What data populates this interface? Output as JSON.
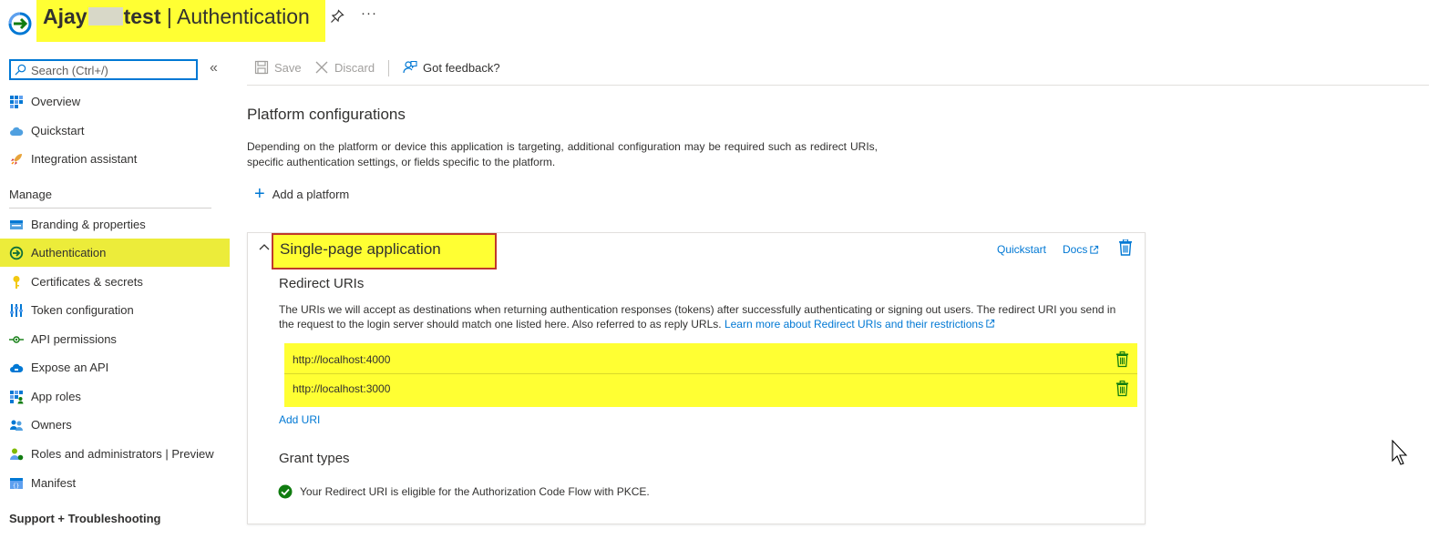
{
  "header": {
    "app_name_start": "Ajay",
    "app_name_end": "test",
    "separator": " | ",
    "page": "Authentication",
    "more": "···"
  },
  "sidebar": {
    "search_placeholder": "Search (Ctrl+/)",
    "collapse": "«",
    "items": [
      {
        "label": "Overview",
        "icon": "grid-icon"
      },
      {
        "label": "Quickstart",
        "icon": "cloud-icon"
      },
      {
        "label": "Integration assistant",
        "icon": "rocket-icon"
      }
    ],
    "manage_label": "Manage",
    "manage_items": [
      {
        "label": "Branding & properties",
        "icon": "branding-icon"
      },
      {
        "label": "Authentication",
        "icon": "authentication-icon",
        "active": true
      },
      {
        "label": "Certificates & secrets",
        "icon": "key-icon"
      },
      {
        "label": "Token configuration",
        "icon": "token-icon"
      },
      {
        "label": "API permissions",
        "icon": "api-permissions-icon"
      },
      {
        "label": "Expose an API",
        "icon": "cloud-api-icon"
      },
      {
        "label": "App roles",
        "icon": "app-roles-icon"
      },
      {
        "label": "Owners",
        "icon": "owners-icon"
      },
      {
        "label": "Roles and administrators | Preview",
        "icon": "roles-icon"
      },
      {
        "label": "Manifest",
        "icon": "manifest-icon"
      }
    ],
    "support_label": "Support + Troubleshooting"
  },
  "toolbar": {
    "save": "Save",
    "discard": "Discard",
    "feedback": "Got feedback?"
  },
  "main": {
    "title": "Platform configurations",
    "description": "Depending on the platform or device this application is targeting, additional configuration may be required such as redirect URIs, specific authentication settings, or fields specific to the platform.",
    "add_platform": "Add a platform"
  },
  "card": {
    "title": "Single-page application",
    "quickstart": "Quickstart",
    "docs": "Docs",
    "redirect_title": "Redirect URIs",
    "redirect_desc": "The URIs we will accept as destinations when returning authentication responses (tokens) after successfully authenticating or signing out users. The redirect URI you send in the request to the login server should match one listed here. Also referred to as reply URLs. ",
    "redirect_link": "Learn more about Redirect URIs and their restrictions",
    "uris": [
      "http://localhost:4000",
      "http://localhost:3000"
    ],
    "add_uri": "Add URI",
    "grant_title": "Grant types",
    "grant_msg": "Your Redirect URI is eligible for the Authorization Code Flow with PKCE."
  },
  "colors": {
    "accent": "#0078d4",
    "highlight": "#ffff33",
    "active_nav": "#ecec3a",
    "annotation_border": "#c0392b",
    "success": "#107c10"
  }
}
